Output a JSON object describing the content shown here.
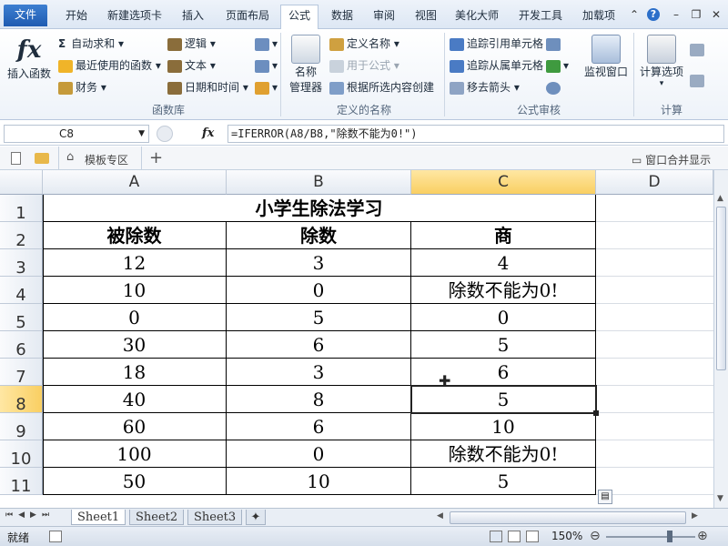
{
  "ribbon_tabs": [
    "文件",
    "开始",
    "新建选项卡",
    "插入",
    "页面布局",
    "公式",
    "数据",
    "审阅",
    "视图",
    "美化大师",
    "开发工具",
    "加载项"
  ],
  "ribbon": {
    "insert_function": "插入函数",
    "autosum": "自动求和",
    "recent": "最近使用的函数",
    "finance": "财务",
    "logic": "逻辑",
    "text": "文本",
    "datetime": "日期和时间",
    "group_library": "函数库",
    "name_manager_1": "名称",
    "name_manager_2": "管理器",
    "define_name": "定义名称",
    "use_in_formula": "用于公式",
    "create_from_selection": "根据所选内容创建",
    "group_names": "定义的名称",
    "trace_precedents": "追踪引用单元格",
    "trace_dependents": "追踪从属单元格",
    "remove_arrows": "移去箭头",
    "group_audit": "公式审核",
    "watch_window": "监视窗口",
    "calc_options": "计算选项",
    "group_calc": "计算"
  },
  "formula_bar": {
    "name_box": "C8",
    "fx_label": "fx",
    "formula": "=IFERROR(A8/B8,\"除数不能为0!\")"
  },
  "doc_bar": {
    "template_zone": "模板专区",
    "merge_windows": "窗口合并显示"
  },
  "columns": [
    "A",
    "B",
    "C",
    "D"
  ],
  "rows": [
    "1",
    "2",
    "3",
    "4",
    "5",
    "6",
    "7",
    "8",
    "9",
    "10",
    "11"
  ],
  "table": {
    "title": "小学生除法学习",
    "headers": [
      "被除数",
      "除数",
      "商"
    ],
    "data": [
      [
        "12",
        "3",
        "4"
      ],
      [
        "10",
        "0",
        "除数不能为0!"
      ],
      [
        "0",
        "5",
        "0"
      ],
      [
        "30",
        "6",
        "5"
      ],
      [
        "18",
        "3",
        "6"
      ],
      [
        "40",
        "8",
        "5"
      ],
      [
        "60",
        "6",
        "10"
      ],
      [
        "100",
        "0",
        "除数不能为0!"
      ],
      [
        "50",
        "10",
        "5"
      ]
    ]
  },
  "sheets": [
    "Sheet1",
    "Sheet2",
    "Sheet3"
  ],
  "status": {
    "ready": "就绪",
    "zoom": "150%"
  },
  "colors": {
    "accent": "#1e5bb1",
    "selected_header": "#f9cf62"
  }
}
